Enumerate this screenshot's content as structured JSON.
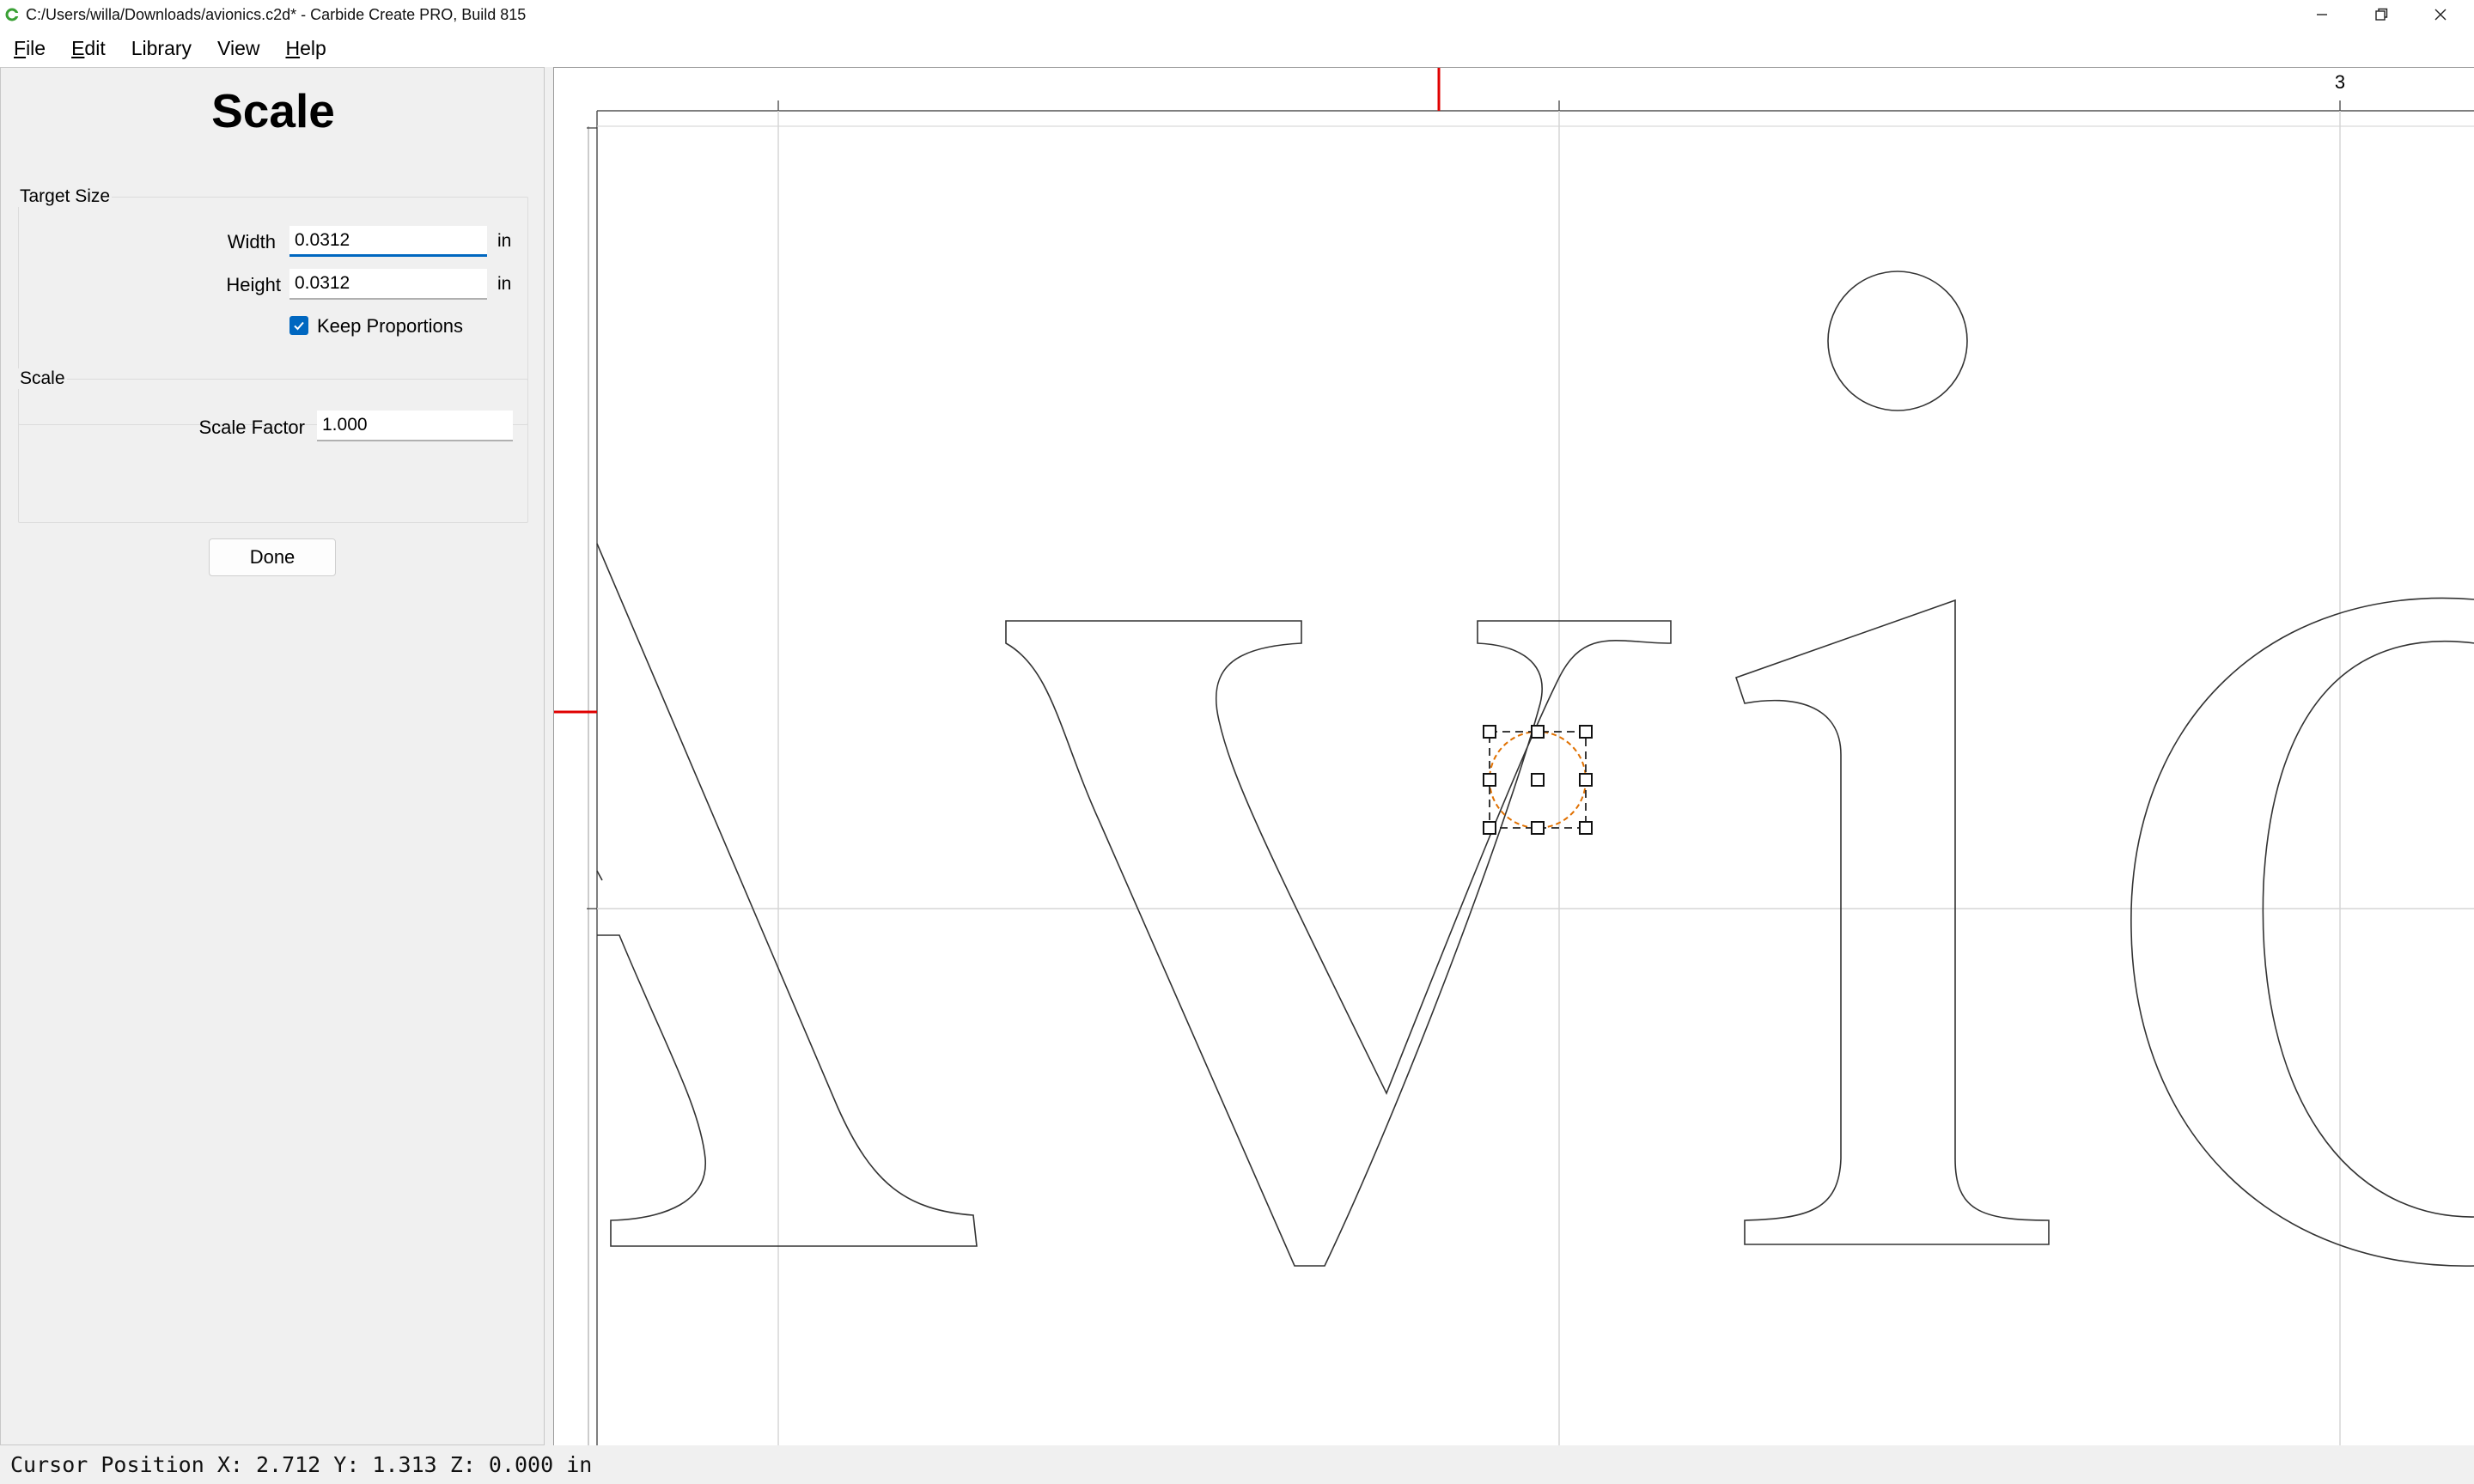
{
  "window": {
    "title": "C:/Users/willa/Downloads/avionics.c2d* - Carbide Create PRO, Build 815",
    "app_icon": "carbide-create-logo-icon",
    "controls": [
      "minimize-icon",
      "restore-icon",
      "close-icon"
    ]
  },
  "menu": {
    "items": [
      {
        "label": "File",
        "mnemonic": "F",
        "rest": "ile"
      },
      {
        "label": "Edit",
        "mnemonic": "E",
        "rest": "dit"
      },
      {
        "label": "Library",
        "mnemonic": "",
        "rest": "Library"
      },
      {
        "label": "View",
        "mnemonic": "",
        "rest": "View"
      },
      {
        "label": "Help",
        "mnemonic": "H",
        "rest": "elp"
      }
    ]
  },
  "panel": {
    "title": "Scale",
    "target_size": {
      "label": "Target Size",
      "width_label": "Width",
      "width_value": "0.0312",
      "width_unit": "in",
      "height_label": "Height",
      "height_value": "0.0312",
      "height_unit": "in",
      "keep_proportions_label": "Keep Proportions",
      "keep_proportions_checked": true
    },
    "scale": {
      "label": "Scale",
      "factor_label": "Scale Factor",
      "factor_value": "1.000"
    },
    "done_label": "Done"
  },
  "canvas": {
    "ruler_label": "3",
    "accent_color": "#e00000",
    "selection_color": "#e07000"
  },
  "status": {
    "text": "Cursor Position X: 2.712 Y: 1.313 Z: 0.000 in"
  }
}
